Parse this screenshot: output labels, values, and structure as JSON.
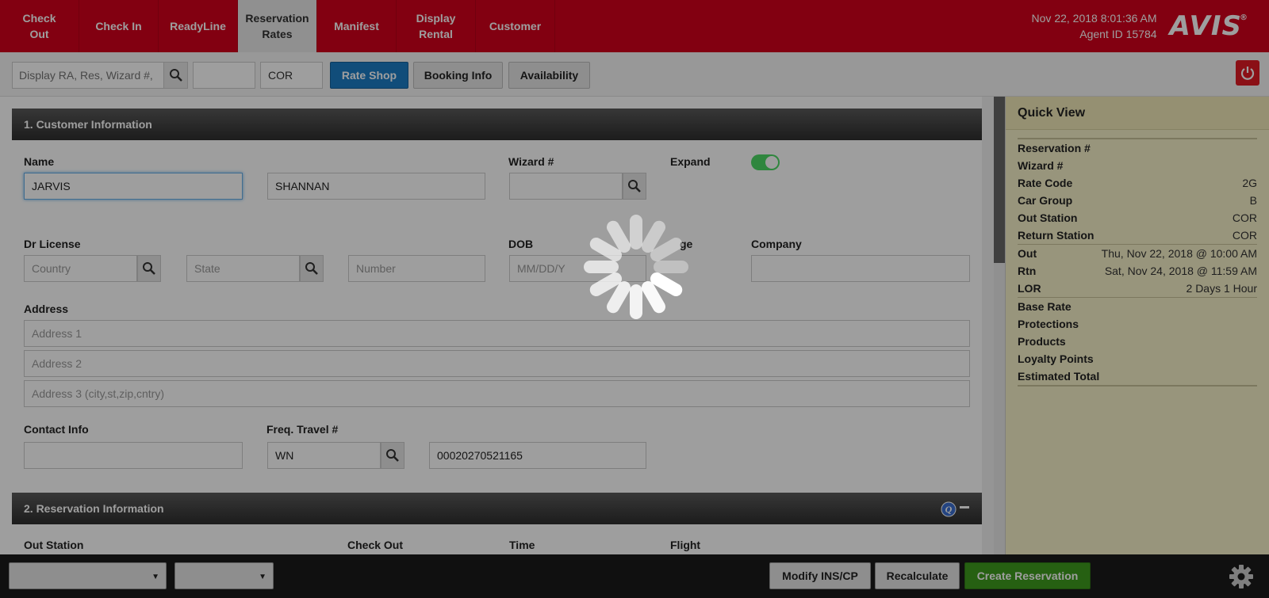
{
  "nav": {
    "tabs": [
      {
        "label": "Check\nOut",
        "active": false
      },
      {
        "label": "Check In",
        "active": false
      },
      {
        "label": "ReadyLine",
        "active": false
      },
      {
        "label": "Reservation\nRates",
        "active": true
      },
      {
        "label": "Manifest",
        "active": false
      },
      {
        "label": "Display\nRental",
        "active": false
      },
      {
        "label": "Customer",
        "active": false
      }
    ],
    "datetime": "Nov 22, 2018 8:01:36 AM",
    "agent": "Agent ID 15784",
    "logo": "AVIS",
    "logo_mark": "®"
  },
  "toolbar": {
    "search_placeholder": "Display RA, Res, Wizard #,",
    "field2_value": "",
    "station_value": "COR",
    "rate_shop_label": "Rate Shop",
    "booking_info_label": "Booking Info",
    "availability_label": "Availability"
  },
  "customer": {
    "section_title": "1. Customer Information",
    "name_label": "Name",
    "last_name": "JARVIS",
    "first_name": "SHANNAN",
    "wizard_label": "Wizard #",
    "wizard_value": "",
    "expand_label": "Expand",
    "expand_on": true,
    "license_label": "Dr License",
    "country_placeholder": "Country",
    "state_placeholder": "State",
    "number_placeholder": "Number",
    "dob_label": "DOB",
    "dob_placeholder": "MM/DD/Y",
    "age_label_partial": "ge",
    "company_label": "Company",
    "company_value": "",
    "address_label": "Address",
    "address1_placeholder": "Address 1",
    "address2_placeholder": "Address 2",
    "address3_placeholder": "Address 3 (city,st,zip,cntry)",
    "contact_label": "Contact Info",
    "contact_value": "",
    "freq_label": "Freq. Travel #",
    "freq_carrier": "WN",
    "freq_number": "00020270521165"
  },
  "reservation": {
    "section_title": "2. Reservation Information",
    "out_station_label": "Out Station",
    "check_out_label": "Check Out",
    "time_label": "Time",
    "flight_label": "Flight"
  },
  "quickview": {
    "title": "Quick View",
    "group1": [
      {
        "k": "Reservation #",
        "v": ""
      },
      {
        "k": "Wizard #",
        "v": ""
      },
      {
        "k": "Rate Code",
        "v": "2G"
      },
      {
        "k": "Car Group",
        "v": "B"
      },
      {
        "k": "Out Station",
        "v": "COR"
      },
      {
        "k": "Return Station",
        "v": "COR"
      }
    ],
    "group2": [
      {
        "k": "Out",
        "v": "Thu, Nov 22, 2018 @ 10:00 AM"
      },
      {
        "k": "Rtn",
        "v": "Sat, Nov 24, 2018 @ 11:59 AM"
      },
      {
        "k": "LOR",
        "v": "2 Days 1 Hour"
      }
    ],
    "group3": [
      {
        "k": "Base Rate",
        "v": ""
      },
      {
        "k": "Protections",
        "v": ""
      },
      {
        "k": "Products",
        "v": ""
      },
      {
        "k": "Loyalty Points",
        "v": ""
      },
      {
        "k": "Estimated Total",
        "v": ""
      }
    ]
  },
  "bottom": {
    "select1_value": "",
    "select2_value": "",
    "modify_label": "Modify INS/CP",
    "recalc_label": "Recalculate",
    "create_label": "Create Reservation"
  },
  "colors": {
    "brand_red": "#d2001c",
    "primary_blue": "#1c7cc6",
    "create_green": "#3e9b1e",
    "quickview_bg": "#f5f0c8"
  },
  "loading": true
}
